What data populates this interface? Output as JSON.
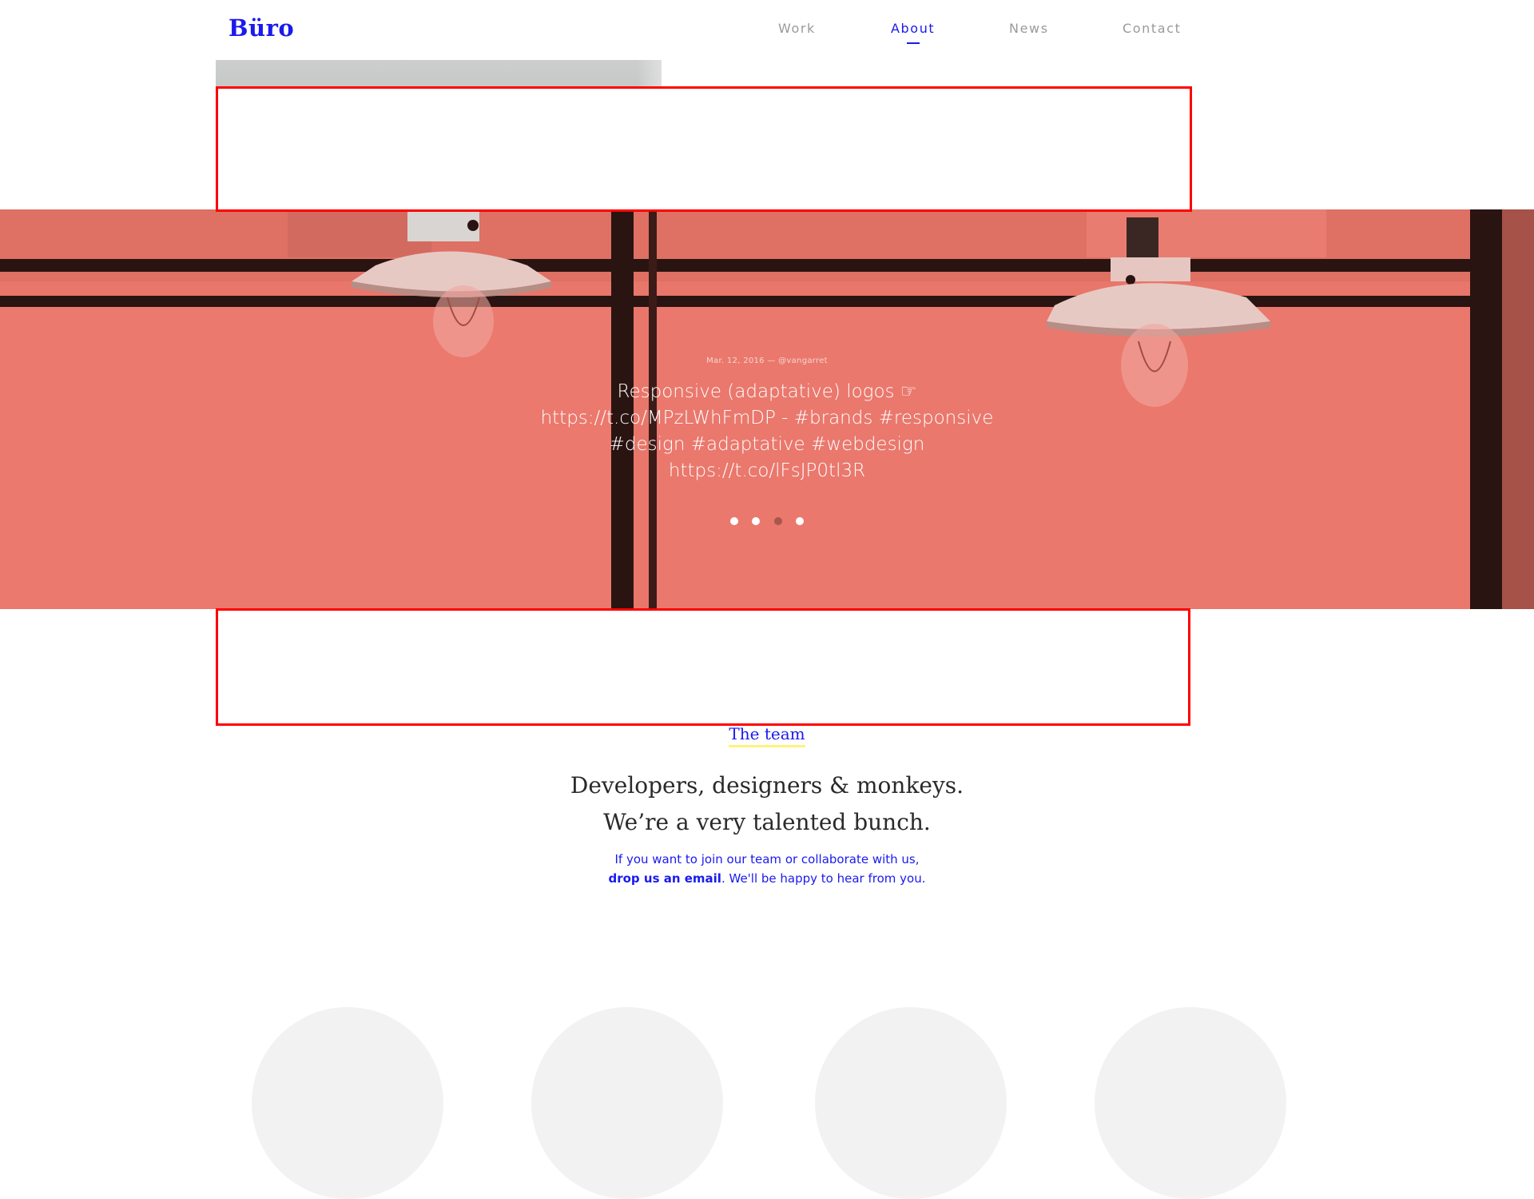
{
  "header": {
    "logo": "Büro",
    "nav": [
      {
        "label": "Work",
        "active": false
      },
      {
        "label": "About",
        "active": true
      },
      {
        "label": "News",
        "active": false
      },
      {
        "label": "Contact",
        "active": false
      }
    ]
  },
  "hero": {
    "tweet_meta": "Mar. 12, 2016 — @vangarret",
    "tweet_text": "Responsive (adaptative) logos ☞ https://t.co/MPzLWhFmDP - #brands #responsive #design #adaptative #webdesign https://t.co/lFsJP0tl3R",
    "dots": {
      "count": 4,
      "active_index": 2
    },
    "overlay_color": "#e9766a"
  },
  "team": {
    "link_label": "The team",
    "heading_line1": "Developers, designers & monkeys.",
    "heading_line2": "We’re a very talented bunch.",
    "sub_line1": "If you want to join our team or collaborate with us,",
    "sub_link": "drop us an email",
    "sub_line2_rest": ". We'll be happy to hear from you."
  },
  "colors": {
    "accent": "#1a1aee",
    "highlight": "#fff27a",
    "annotation": "#ff0000"
  }
}
